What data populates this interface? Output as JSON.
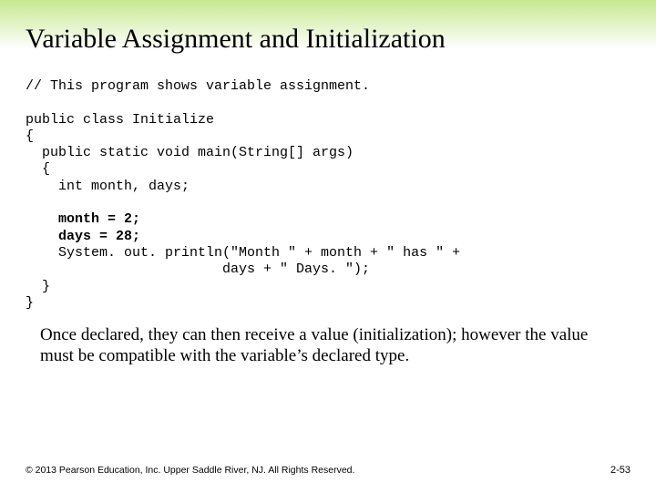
{
  "title": "Variable Assignment and Initialization",
  "code": {
    "l1": "// This program shows variable assignment.",
    "l2": "public class Initialize",
    "l3": "{",
    "l4": "  public static void main(String[] args)",
    "l5": "  {",
    "l6": "    int month, days;",
    "l7": "    month = 2;",
    "l8": "    days = 28;",
    "l9": "    System. out. println(\"Month \" + month + \" has \" +",
    "l10": "                        days + \" Days. \");",
    "l11": "  }",
    "l12": "}"
  },
  "body": "Once declared, they can then receive a value (initialization); however the value must be compatible with the variable’s declared type.",
  "footer_left": "© 2013 Pearson Education, Inc. Upper Saddle River, NJ. All Rights Reserved.",
  "footer_right": "2-53"
}
